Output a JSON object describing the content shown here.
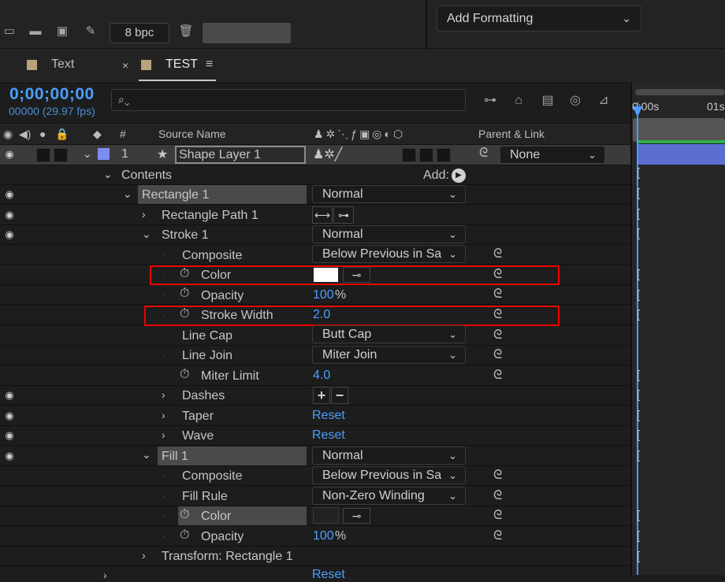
{
  "toolbar": {
    "bpc": "8 bpc",
    "icons": [
      "render-queue-icon",
      "folder-icon",
      "composition-icon",
      "pen-icon",
      "trash-icon"
    ]
  },
  "formatting": {
    "label": "Add Formatting"
  },
  "tabs": [
    {
      "label": "Text"
    },
    {
      "label": "TEST"
    }
  ],
  "tab_close": "×",
  "tab_menu": "≡",
  "timecode": "0;00;00;00",
  "framerate": "00000 (29.97 fps)",
  "timeline": {
    "left_label": "0:00s",
    "right_label": "01s",
    "playhead_frame": 0
  },
  "headers": {
    "num": "#",
    "source": "Source Name",
    "parent": "Parent & Link"
  },
  "layer": {
    "num": "1",
    "name": "Shape Layer 1",
    "parent": "None"
  },
  "rows": {
    "contents": "Contents",
    "add": "Add:",
    "rect": "Rectangle 1",
    "rect_mode": "Normal",
    "rect_path": "Rectangle Path 1",
    "stroke": "Stroke 1",
    "stroke_mode": "Normal",
    "composite": "Composite",
    "composite_val": "Below Previous in Sa",
    "color": "Color",
    "opacity": "Opacity",
    "opacity_val": "100",
    "pct": "%",
    "stroke_width": "Stroke Width",
    "stroke_width_val": "2.0",
    "line_cap": "Line Cap",
    "line_cap_val": "Butt Cap",
    "line_join": "Line Join",
    "line_join_val": "Miter Join",
    "miter": "Miter Limit",
    "miter_val": "4.0",
    "dashes": "Dashes",
    "taper": "Taper",
    "taper_val": "Reset",
    "wave": "Wave",
    "wave_val": "Reset",
    "fill": "Fill 1",
    "fill_mode": "Normal",
    "fill_composite": "Composite",
    "fill_composite_val": "Below Previous in Sa",
    "fill_rule": "Fill Rule",
    "fill_rule_val": "Non-Zero Winding",
    "fill_color": "Color",
    "fill_opacity": "Opacity",
    "fill_opacity_val": "100",
    "transform": "Transform: Rectangle 1",
    "last_val": "Reset"
  },
  "colors": {
    "accent": "#4aa0ff",
    "highlight": "#e00000",
    "stroke_color": "#ffffff",
    "fill_color": "#222222",
    "layer_bar": "#5b6ed0",
    "label_color": "#7c8cf0"
  }
}
